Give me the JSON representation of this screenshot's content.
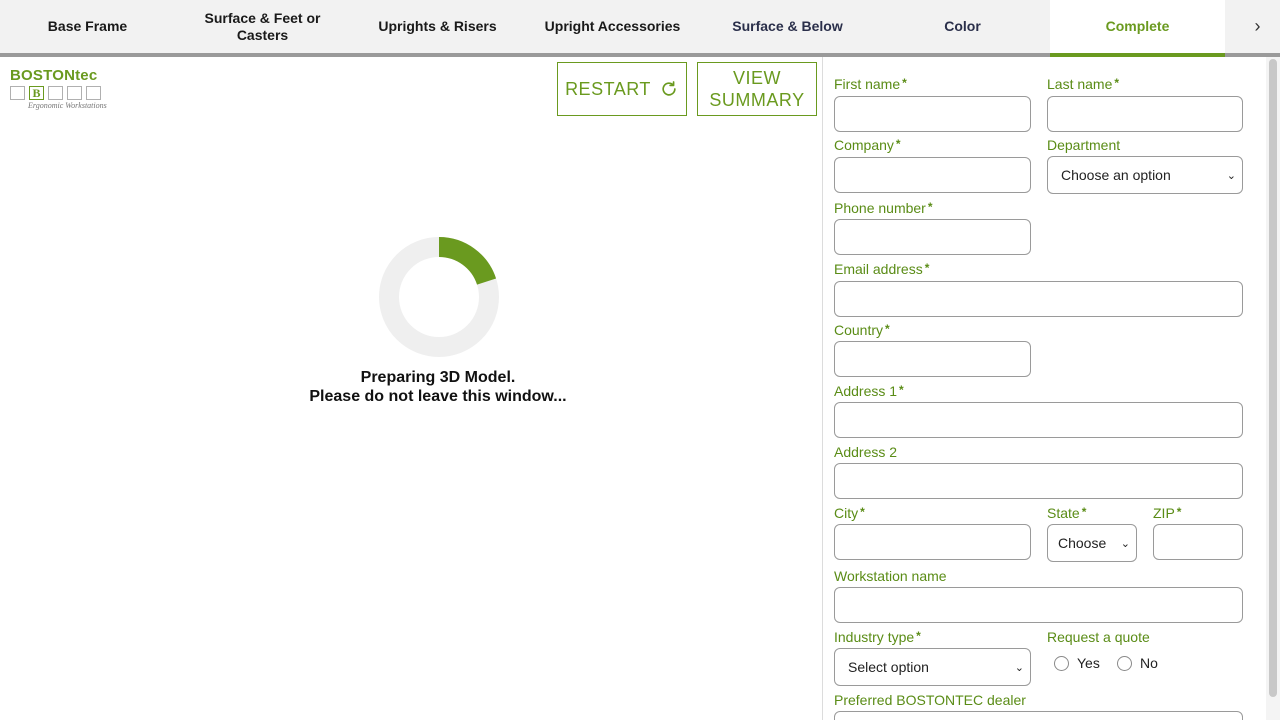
{
  "tabs": [
    {
      "label": "Base Frame",
      "state": "normal"
    },
    {
      "label": "Surface & Feet or Casters",
      "state": "normal"
    },
    {
      "label": "Uprights & Risers",
      "state": "normal"
    },
    {
      "label": "Upright Accessories",
      "state": "normal"
    },
    {
      "label": "Surface & Below",
      "state": "dim"
    },
    {
      "label": "Color",
      "state": "dim"
    },
    {
      "label": "Complete",
      "state": "active"
    }
  ],
  "tab_next_icon": "chevron-right-icon",
  "logo": {
    "wordmark": "BOSTONtec",
    "letter": "B",
    "tagline": "Ergonomic Workstations"
  },
  "toolbar": {
    "restart_label": "RESTART",
    "restart_icon": "refresh-icon",
    "view_summary_line1": "VIEW",
    "view_summary_line2": "SUMMARY"
  },
  "loading": {
    "line1": "Preparing 3D Model.",
    "line2": "Please do not leave this window...",
    "progress_fraction": 0.2
  },
  "form": {
    "first_name_label": "First name",
    "last_name_label": "Last name",
    "company_label": "Company",
    "department_label": "Department",
    "department_value": "Choose an option",
    "phone_label": "Phone number",
    "email_label": "Email address",
    "country_label": "Country",
    "address1_label": "Address 1",
    "address2_label": "Address 2",
    "city_label": "City",
    "state_label": "State",
    "state_value": "Choose",
    "zip_label": "ZIP",
    "workstation_label": "Workstation name",
    "industry_label": "Industry type",
    "industry_value": "Select option",
    "quote_label": "Request a quote",
    "quote_yes": "Yes",
    "quote_no": "No",
    "dealer_label": "Preferred BOSTONTEC dealer",
    "required_mark": "*"
  },
  "colors": {
    "accent": "#6a9a1f",
    "label_green": "#5a8c16",
    "tab_bar_bg": "#f2f2f2",
    "spinner_track": "#efefef"
  }
}
